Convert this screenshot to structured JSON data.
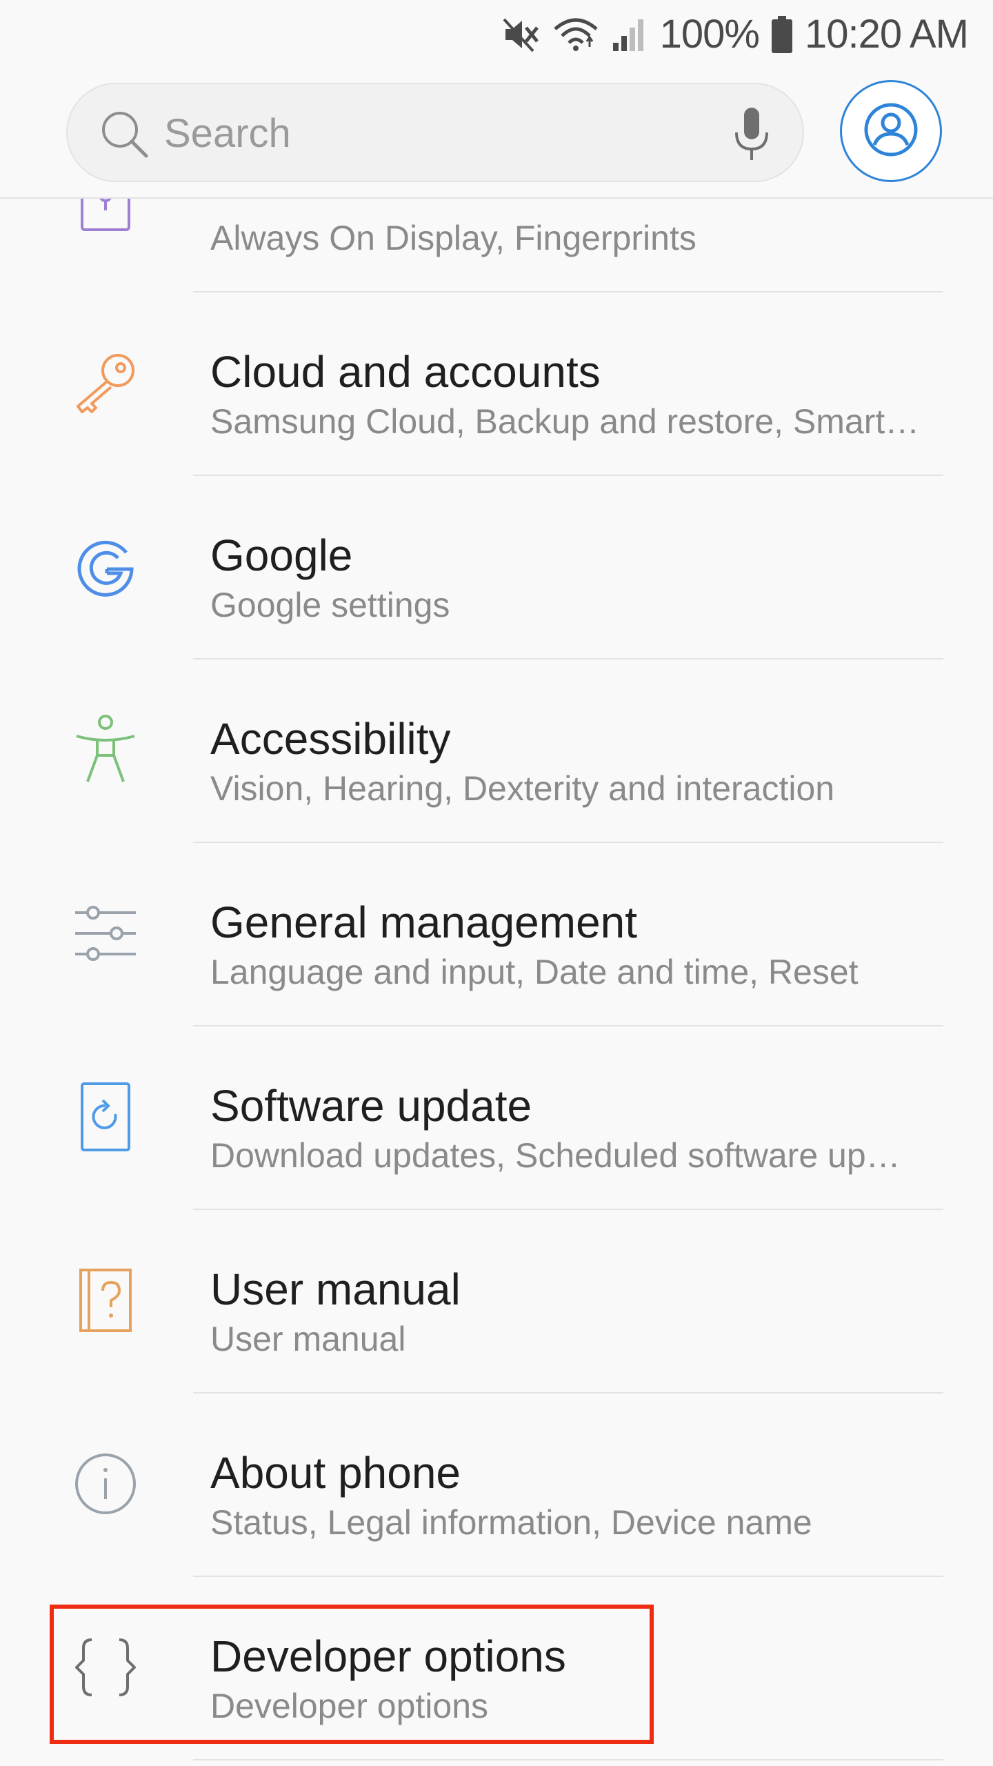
{
  "status_bar": {
    "battery_percent": "100%",
    "time": "10:20 AM"
  },
  "search": {
    "placeholder": "Search"
  },
  "settings_items": [
    {
      "title": "",
      "subtitle": "Always On Display, Fingerprints",
      "icon": "lock-screen-security-icon",
      "color": "#9d7fd6"
    },
    {
      "title": "Cloud and accounts",
      "subtitle": "Samsung Cloud, Backup and restore, Smart…",
      "icon": "key-icon",
      "color": "#f19a5c"
    },
    {
      "title": "Google",
      "subtitle": "Google settings",
      "icon": "google-g-icon",
      "color": "#4f8ee8"
    },
    {
      "title": "Accessibility",
      "subtitle": "Vision, Hearing, Dexterity and interaction",
      "icon": "accessibility-person-icon",
      "color": "#7cc17a"
    },
    {
      "title": "General management",
      "subtitle": "Language and input, Date and time, Reset",
      "icon": "sliders-icon",
      "color": "#9aa3ab"
    },
    {
      "title": "Software update",
      "subtitle": "Download updates, Scheduled software up…",
      "icon": "software-update-icon",
      "color": "#4f9be8"
    },
    {
      "title": "User manual",
      "subtitle": "User manual",
      "icon": "user-manual-book-icon",
      "color": "#e6a25c"
    },
    {
      "title": "About phone",
      "subtitle": "Status, Legal information, Device name",
      "icon": "info-circle-icon",
      "color": "#9aa3ab"
    },
    {
      "title": "Developer options",
      "subtitle": "Developer options",
      "icon": "curly-braces-icon",
      "color": "#6e6e6e"
    }
  ],
  "colors": {
    "background": "#f9f9f9",
    "accent": "#2e84d9",
    "highlight_border": "#ee2c12"
  }
}
